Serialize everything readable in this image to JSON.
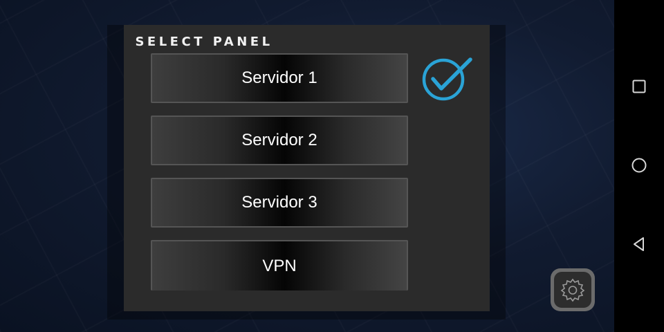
{
  "panel": {
    "title": "SELECT PANEL",
    "selected_index": 0,
    "options": [
      {
        "label": "Servidor 1"
      },
      {
        "label": "Servidor 2"
      },
      {
        "label": "Servidor 3"
      },
      {
        "label": "VPN"
      }
    ]
  },
  "icons": {
    "check": "check-circle-icon",
    "settings": "gear-icon",
    "nav_recents": "square-icon",
    "nav_home": "circle-icon",
    "nav_back": "triangle-back-icon"
  },
  "colors": {
    "accent": "#2aa3d6",
    "panel_bg": "#2b2b2b",
    "text": "#ffffff"
  }
}
